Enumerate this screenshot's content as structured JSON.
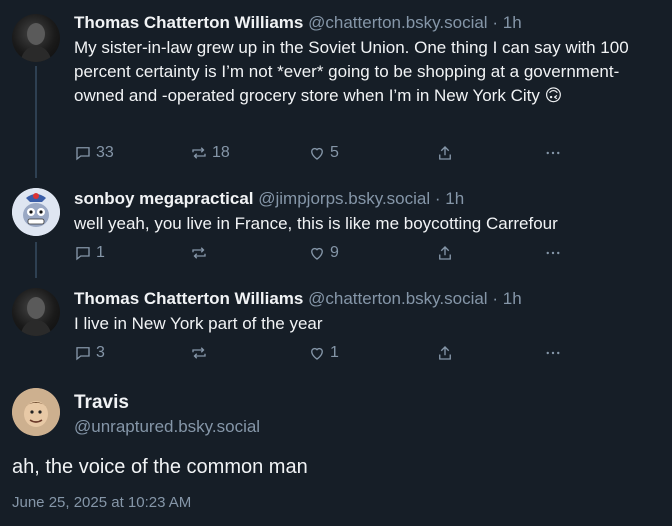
{
  "posts": [
    {
      "name": "Thomas Chatterton Williams",
      "handle": "@chatterton.bsky.social",
      "dot": "·",
      "time": "1h",
      "text": "My sister-in-law grew up in the Soviet Union. One thing I can say with 100 percent certainty is I’m not *ever* going to be shopping at a government-owned and -operated grocery store when I’m in New York City 🙃",
      "replies": "33",
      "reposts": "18",
      "likes": "5"
    },
    {
      "name": "sonboy megapractical",
      "handle": "@jimpjorps.bsky.social",
      "dot": "·",
      "time": "1h",
      "text": "well yeah, you live in France, this is like me boycotting Carrefour",
      "replies": "1",
      "reposts": "",
      "likes": "9"
    },
    {
      "name": "Thomas Chatterton Williams",
      "handle": "@chatterton.bsky.social",
      "dot": "·",
      "time": "1h",
      "text": "I live in New York part of the year",
      "replies": "3",
      "reposts": "",
      "likes": "1"
    }
  ],
  "main": {
    "name": "Travis",
    "handle": "@unraptured.bsky.social",
    "text": "ah, the voice of the common man",
    "date": "June 25, 2025 at 10:23 AM"
  },
  "icons": {
    "reply": "reply-icon",
    "repost": "repost-icon",
    "like": "heart-icon",
    "share": "share-icon",
    "more": "more-icon"
  },
  "colors": {
    "background": "#161e27",
    "muted": "#8596a8",
    "thread_line": "#2e4052",
    "text": "#f1f3f5"
  }
}
